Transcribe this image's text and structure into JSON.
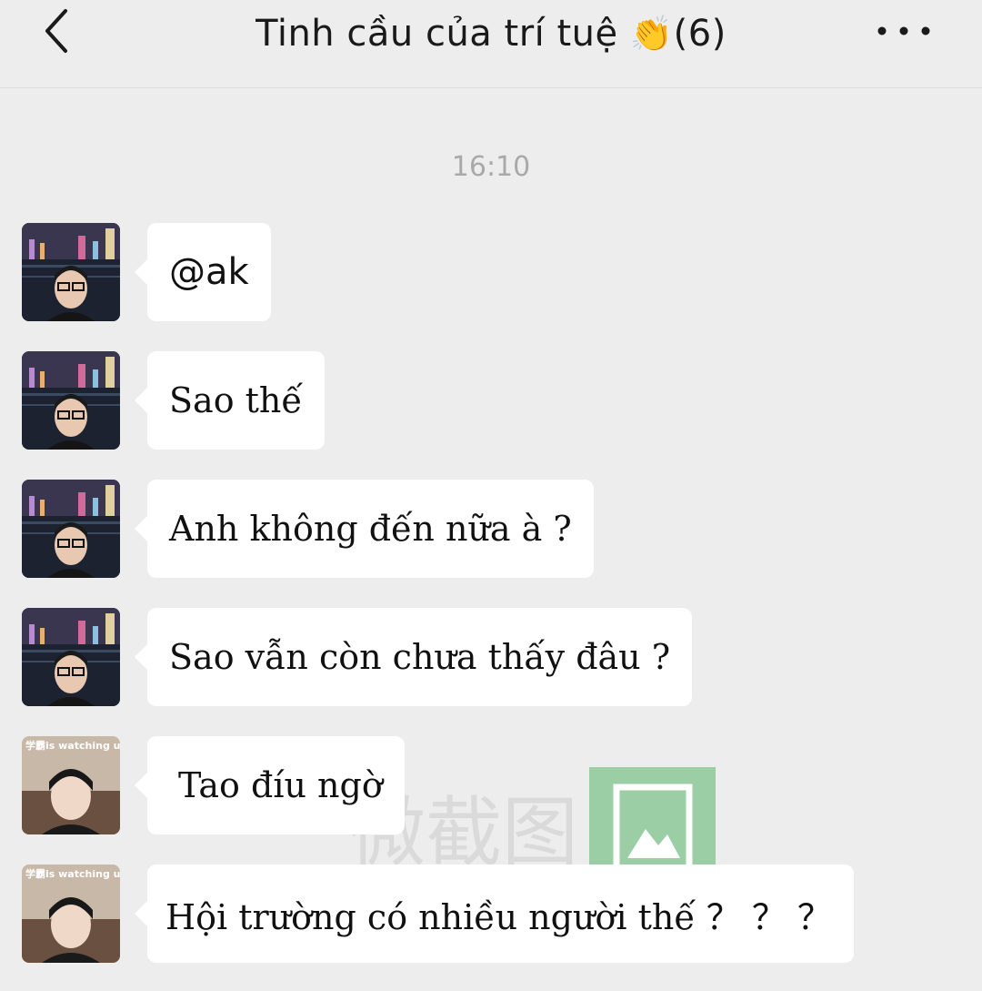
{
  "header": {
    "title": "Tinh cầu của trí tuệ",
    "emoji": "👏",
    "member_count": "(6)"
  },
  "timestamp": "16:10",
  "messages": [
    {
      "sender": "user1",
      "text": "@ak"
    },
    {
      "sender": "user1",
      "text": "Sao thế"
    },
    {
      "sender": "user1",
      "text": "Anh không đến nữa à ?"
    },
    {
      "sender": "user1",
      "text": "Sao vẫn còn chưa thấy đâu ?"
    },
    {
      "sender": "user2",
      "text": "Tao đíu ngờ"
    },
    {
      "sender": "user2",
      "text": "Hội trường có nhiều người thế ？ ？ ？"
    }
  ],
  "avatars": {
    "user2_caption": "学霸is watching u"
  },
  "watermark": {
    "text": "微截图"
  },
  "icons": {
    "back": "chevron-left-icon",
    "more": "more-dots-icon",
    "watermark_logo": "image-icon"
  },
  "colors": {
    "background": "#ededed",
    "bubble": "#ffffff",
    "timestamp": "#a9a9a9",
    "text": "#111111"
  }
}
